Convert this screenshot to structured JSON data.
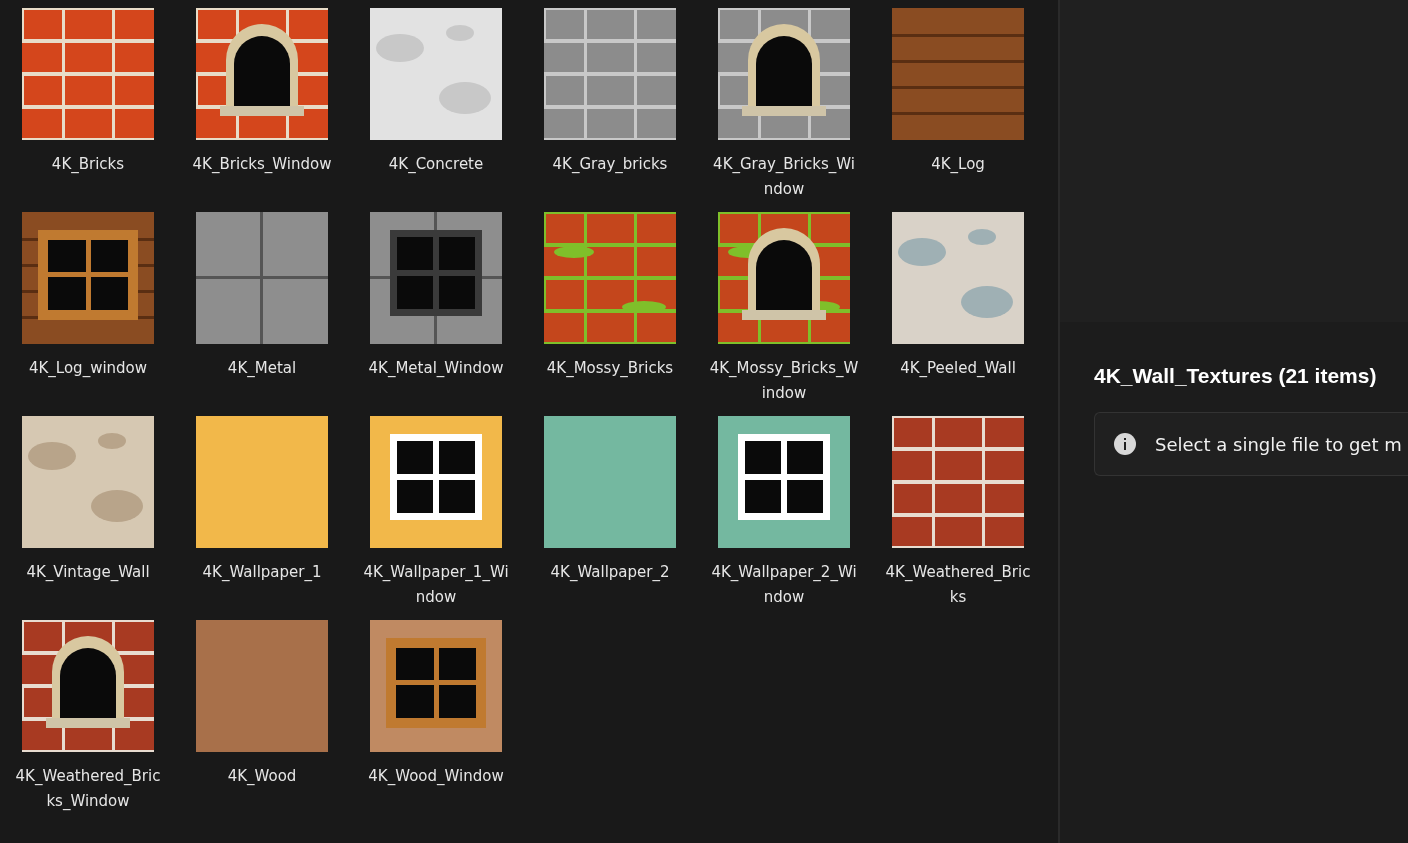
{
  "items": [
    {
      "name": "4K_Bricks",
      "kind": "picture"
    },
    {
      "name": "4K_Bricks_Window",
      "kind": "picture"
    },
    {
      "name": "4K_Concrete",
      "kind": "picture"
    },
    {
      "name": "4K_Gray_bricks",
      "kind": "picture"
    },
    {
      "name": "4K_Gray_Bricks_Window",
      "kind": "picture"
    },
    {
      "name": "4K_Log",
      "kind": "picture"
    },
    {
      "name": "4K_Log_window",
      "kind": "picture"
    },
    {
      "name": "4K_Metal",
      "kind": "picture"
    },
    {
      "name": "4K_Metal_Window",
      "kind": "picture"
    },
    {
      "name": "4K_Mossy_Bricks",
      "kind": "picture"
    },
    {
      "name": "4K_Mossy_Bricks_Window",
      "kind": "picture"
    },
    {
      "name": "4K_Peeled_Wall",
      "kind": "picture"
    },
    {
      "name": "4K_Vintage_Wall",
      "kind": "picture"
    },
    {
      "name": "4K_Wallpaper_1",
      "kind": "picture"
    },
    {
      "name": "4K_Wallpaper_1_Window",
      "kind": "picture"
    },
    {
      "name": "4K_Wallpaper_2",
      "kind": "picture"
    },
    {
      "name": "4K_Wallpaper_2_Window",
      "kind": "picture"
    },
    {
      "name": "4K_Weathered_Bricks",
      "kind": "picture"
    },
    {
      "name": "4K_Weathered_Bricks_Window",
      "kind": "picture"
    },
    {
      "name": "4K_Wood",
      "kind": "picture"
    },
    {
      "name": "4K_Wood_Window",
      "kind": "picture"
    }
  ],
  "details": {
    "title": "4K_Wall_Textures (21 items)",
    "info": "Select a single file to get m"
  }
}
